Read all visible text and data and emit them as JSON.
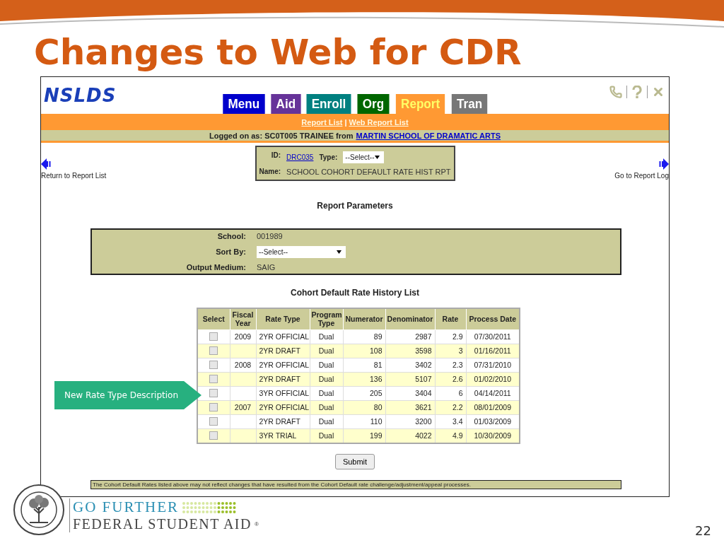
{
  "slide": {
    "title": "Changes to Web for CDR",
    "page_number": "22"
  },
  "app": {
    "logo": "NSLDS",
    "tabs": [
      {
        "label": "Menu",
        "color": "#0000cc",
        "selected": false
      },
      {
        "label": "Aid",
        "color": "#663399",
        "selected": false
      },
      {
        "label": "Enroll",
        "color": "#008080",
        "selected": false
      },
      {
        "label": "Org",
        "color": "#006600",
        "selected": false
      },
      {
        "label": "Report",
        "color": "#ff9933",
        "selected": true
      },
      {
        "label": "Tran",
        "color": "#777777",
        "selected": false
      }
    ],
    "links": [
      "Report List",
      "Web Report List"
    ],
    "link_separator": "|",
    "logon": {
      "text": "Logged on as: SC0T005 TRAINEE from",
      "school": "MARTIN SCHOOL OF DRAMATIC ARTS"
    },
    "nav_back": "Return to Report List",
    "nav_forward": "Go to Report Log",
    "report": {
      "id_label": "ID:",
      "id": "DRC035",
      "type_label": "Type:",
      "type_value": "--Select--",
      "name_label": "Name:",
      "name": "SCHOOL COHORT DEFAULT RATE HIST RPT"
    },
    "parameters_title": "Report Parameters",
    "parameters": [
      {
        "label": "School:",
        "value": "001989",
        "kind": "text"
      },
      {
        "label": "Sort By:",
        "value": "--Select--",
        "kind": "select"
      },
      {
        "label": "Output Medium:",
        "value": "SAIG",
        "kind": "text"
      }
    ],
    "list_title": "Cohort Default Rate History List",
    "table": {
      "columns": [
        "Select",
        "Fiscal Year",
        "Rate Type",
        "Program Type",
        "Numerator",
        "Denominator",
        "Rate",
        "Process Date"
      ],
      "rows": [
        {
          "checked": false,
          "fiscal_year": "2009",
          "rate_type": "2YR OFFICIAL",
          "program_type": "Dual",
          "numerator": "89",
          "denominator": "2987",
          "rate": "2.9",
          "process_date": "07/30/2011"
        },
        {
          "checked": false,
          "rate_type": "2YR DRAFT",
          "program_type": "Dual",
          "numerator": "108",
          "denominator": "3598",
          "rate": "3",
          "process_date": "01/16/2011"
        },
        {
          "checked": false,
          "fiscal_year": "2008",
          "rate_type": "2YR OFFICIAL",
          "program_type": "Dual",
          "numerator": "81",
          "denominator": "3402",
          "rate": "2.3",
          "process_date": "07/31/2010"
        },
        {
          "checked": false,
          "rate_type": "2YR DRAFT",
          "program_type": "Dual",
          "numerator": "136",
          "denominator": "5107",
          "rate": "2.6",
          "process_date": "01/02/2010"
        },
        {
          "checked": false,
          "rate_type": "3YR OFFICIAL",
          "program_type": "Dual",
          "numerator": "205",
          "denominator": "3404",
          "rate": "6",
          "process_date": "04/14/2011"
        },
        {
          "checked": false,
          "fiscal_year": "2007",
          "rate_type": "2YR OFFICIAL",
          "program_type": "Dual",
          "numerator": "80",
          "denominator": "3621",
          "rate": "2.2",
          "process_date": "08/01/2009"
        },
        {
          "checked": false,
          "rate_type": "2YR DRAFT",
          "program_type": "Dual",
          "numerator": "110",
          "denominator": "3200",
          "rate": "3.4",
          "process_date": "01/03/2009"
        },
        {
          "checked": false,
          "rate_type": "3YR TRIAL",
          "program_type": "Dual",
          "numerator": "199",
          "denominator": "4022",
          "rate": "4.9",
          "process_date": "10/30/2009"
        }
      ]
    },
    "submit": "Submit",
    "note": "The Cohort Default Rates listed above may not reflect changes that have resulted from the Cohort Default rate challenge/adjustment/appeal processes."
  },
  "callout": "New Rate Type Description",
  "branding": {
    "line1": "GO FURTHER",
    "line2": "FEDERAL STUDENT AID",
    "mark": "®"
  }
}
